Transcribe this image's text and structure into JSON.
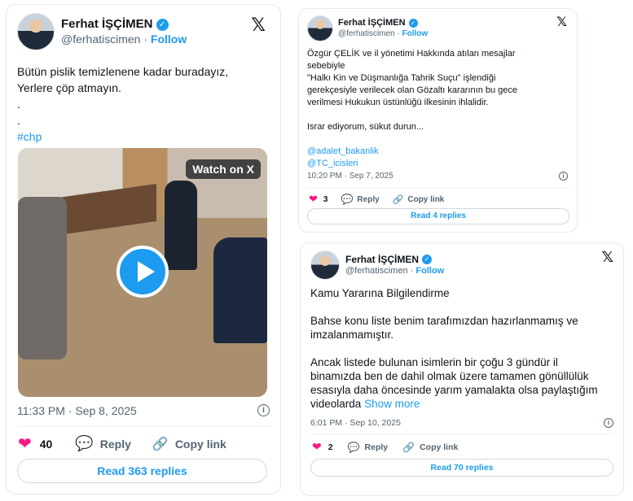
{
  "author": {
    "name": "Ferhat İŞÇİMEN",
    "handle": "@ferhatiscimen",
    "follow": "Follow",
    "verified": "✓"
  },
  "x_logo": "𝕏",
  "post1": {
    "lines": [
      "Bütün pislik temizlenene kadar buradayız,",
      "Yerlere çöp atmayın.",
      ".",
      "."
    ],
    "hashtag": "#chp",
    "video_badge": "Watch on X",
    "time": "11:33 PM · Sep 8, 2025",
    "likes": "40",
    "reply": "Reply",
    "copy": "Copy link",
    "read_replies": "Read 363 replies"
  },
  "post2": {
    "lines": [
      "Özgür ÇELİK ve il yönetimi Hakkında atılan mesajlar",
      "sebebiyle",
      "\"Halkı Kin ve Düşmanlığa Tahrik Suçu\" işlendiği",
      "gerekçesiyle verilecek olan Gözaltı kararının bu gece",
      "verilmesi Hukukun üstünlüğü ilkesinin ihlalidir."
    ],
    "line_insist": "Israr ediyorum, sükut durun...",
    "mention1": "@adalet_bakanlik",
    "mention2": "@TC_icisleri",
    "time": "10:20 PM · Sep 7, 2025",
    "likes": "3",
    "reply": "Reply",
    "copy": "Copy link",
    "read_replies": "Read 4 replies"
  },
  "post3": {
    "heading": "Kamu Yararına Bilgilendirme",
    "para1": [
      "Bahse konu liste benim tarafımızdan hazırlanmamış ve",
      "imzalanmamıştır."
    ],
    "para2": [
      "Ancak listede bulunan isimlerin bir çoğu 3 gündür il",
      "binamızda ben de dahil olmak üzere tamamen gönüllülük",
      "esasıyla daha öncesinde yarım yamalakta olsa paylaştığım",
      "videolarda"
    ],
    "show_more": "Show more",
    "time": "6:01 PM · Sep 10, 2025",
    "likes": "2",
    "reply": "Reply",
    "copy": "Copy link",
    "read_replies": "Read 70 replies"
  },
  "icons": {
    "heart": "heart-icon",
    "reply": "reply-bubble-icon",
    "link": "link-icon",
    "info": "info-icon",
    "play": "play-icon",
    "x": "x-logo-icon"
  },
  "colors": {
    "accent": "#1d9bf0",
    "like": "#f91880",
    "muted": "#536471",
    "border": "#cfd9de"
  }
}
